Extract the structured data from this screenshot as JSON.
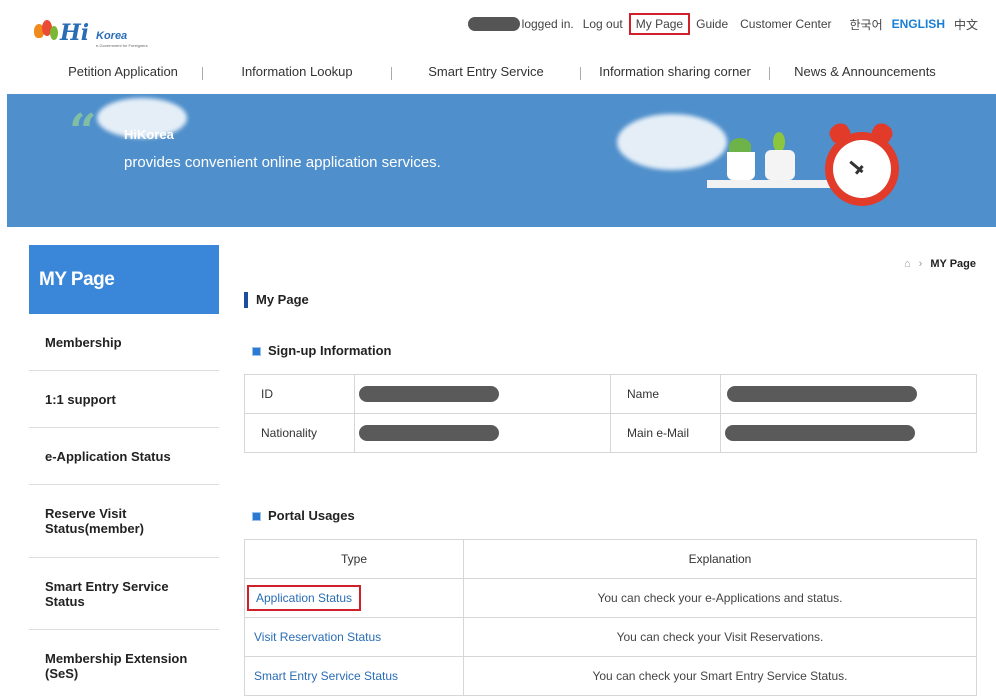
{
  "header": {
    "logo_text": "Hi",
    "logo_sub": "Korea",
    "logo_tagline": "e-Government for Foreigners",
    "logged_in_text": "logged in.",
    "logout": "Log out",
    "my_page": "My Page",
    "guide": "Guide",
    "customer_center": "Customer Center",
    "lang_ko": "한국어",
    "lang_en": "ENGLISH",
    "lang_zh": "中文"
  },
  "gnb": [
    {
      "label": "Petition Application"
    },
    {
      "label": "Information Lookup"
    },
    {
      "label": "Smart Entry Service"
    },
    {
      "label": "Information sharing corner"
    },
    {
      "label": "News & Announcements"
    }
  ],
  "banner": {
    "brand": "HiKorea",
    "description": "provides convenient online application services."
  },
  "sidebar": {
    "title": "MY Page",
    "items": [
      {
        "label": "Membership"
      },
      {
        "label": "1:1 support"
      },
      {
        "label": "e-Application Status"
      },
      {
        "label": "Reserve Visit Status(member)"
      },
      {
        "label": "Smart Entry Service Status"
      },
      {
        "label": "Membership Extension (SeS)"
      }
    ]
  },
  "breadcrumb": {
    "current": "MY Page"
  },
  "page_title": "My Page",
  "signup": {
    "heading": "Sign-up Information",
    "id_label": "ID",
    "name_label": "Name",
    "nationality_label": "Nationality",
    "email_label": "Main e-Mail"
  },
  "portal": {
    "heading": "Portal Usages",
    "col_type": "Type",
    "col_explanation": "Explanation",
    "rows": [
      {
        "type": "Application Status",
        "explanation": "You can check your e-Applications and status."
      },
      {
        "type": "Visit Reservation Status",
        "explanation": "You can check your Visit Reservations."
      },
      {
        "type": "Smart Entry Service Status",
        "explanation": "You can check your Smart Entry Service Status."
      }
    ]
  },
  "colors": {
    "accent": "#3a86d9",
    "highlight": "#d0202a",
    "banner": "#4f8fcb"
  }
}
